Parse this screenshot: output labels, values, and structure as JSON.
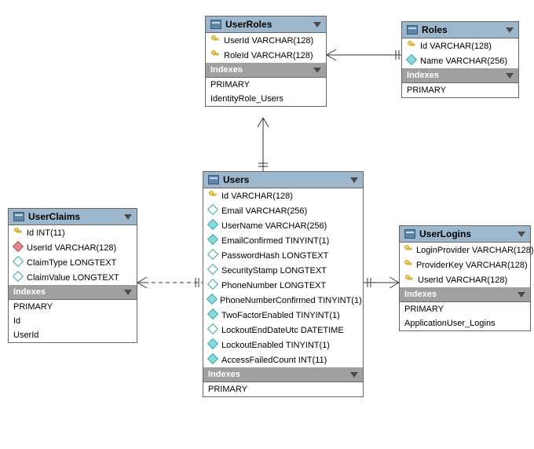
{
  "tables": {
    "userRoles": {
      "title": "UserRoles",
      "columns": [
        {
          "name": "UserId VARCHAR(128)",
          "icon": "key"
        },
        {
          "name": "RoleId VARCHAR(128)",
          "icon": "key"
        }
      ],
      "indexesLabel": "Indexes",
      "indexes": [
        "PRIMARY",
        "IdentityRole_Users"
      ]
    },
    "roles": {
      "title": "Roles",
      "columns": [
        {
          "name": "Id VARCHAR(128)",
          "icon": "key"
        },
        {
          "name": "Name VARCHAR(256)",
          "icon": "cyan-fill"
        }
      ],
      "indexesLabel": "Indexes",
      "indexes": [
        "PRIMARY"
      ]
    },
    "users": {
      "title": "Users",
      "columns": [
        {
          "name": "Id VARCHAR(128)",
          "icon": "key"
        },
        {
          "name": "Email VARCHAR(256)",
          "icon": "cyan"
        },
        {
          "name": "UserName VARCHAR(256)",
          "icon": "cyan-fill"
        },
        {
          "name": "EmailConfirmed TINYINT(1)",
          "icon": "cyan-fill"
        },
        {
          "name": "PasswordHash LONGTEXT",
          "icon": "cyan"
        },
        {
          "name": "SecurityStamp LONGTEXT",
          "icon": "cyan"
        },
        {
          "name": "PhoneNumber LONGTEXT",
          "icon": "cyan"
        },
        {
          "name": "PhoneNumberConfirmed TINYINT(1)",
          "icon": "cyan-fill"
        },
        {
          "name": "TwoFactorEnabled TINYINT(1)",
          "icon": "cyan-fill"
        },
        {
          "name": "LockoutEndDateUtc DATETIME",
          "icon": "cyan"
        },
        {
          "name": "LockoutEnabled TINYINT(1)",
          "icon": "cyan-fill"
        },
        {
          "name": "AccessFailedCount INT(11)",
          "icon": "cyan-fill"
        }
      ],
      "indexesLabel": "Indexes",
      "indexes": [
        "PRIMARY"
      ]
    },
    "userClaims": {
      "title": "UserClaims",
      "columns": [
        {
          "name": "Id INT(11)",
          "icon": "key"
        },
        {
          "name": "UserId VARCHAR(128)",
          "icon": "red"
        },
        {
          "name": "ClaimType LONGTEXT",
          "icon": "cyan"
        },
        {
          "name": "ClaimValue LONGTEXT",
          "icon": "cyan"
        }
      ],
      "indexesLabel": "Indexes",
      "indexes": [
        "PRIMARY",
        "Id",
        "UserId"
      ]
    },
    "userLogins": {
      "title": "UserLogins",
      "columns": [
        {
          "name": "LoginProvider VARCHAR(128)",
          "icon": "key"
        },
        {
          "name": "ProviderKey VARCHAR(128)",
          "icon": "key"
        },
        {
          "name": "UserId VARCHAR(128)",
          "icon": "key"
        }
      ],
      "indexesLabel": "Indexes",
      "indexes": [
        "PRIMARY",
        "ApplicationUser_Logins"
      ]
    }
  },
  "colors": {
    "headerBlue": "#9db8cc",
    "headerGray": "#a0a0a0"
  }
}
